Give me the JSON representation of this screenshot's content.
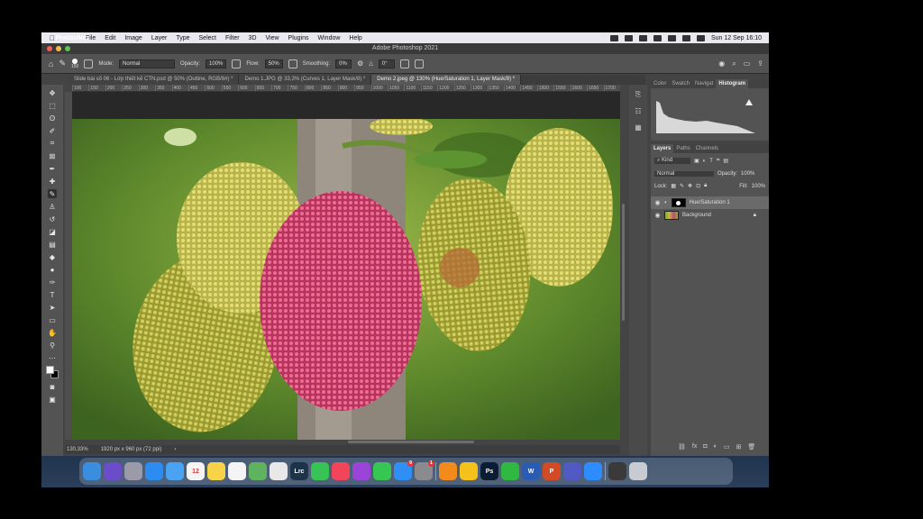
{
  "menubar": {
    "app": "Photoshop",
    "items": [
      "File",
      "Edit",
      "Image",
      "Layer",
      "Type",
      "Select",
      "Filter",
      "3D",
      "View",
      "Plugins",
      "Window",
      "Help"
    ],
    "clock": "Sun 12 Sep  16:10"
  },
  "window": {
    "title": "Adobe Photoshop 2021"
  },
  "options": {
    "brush_size": "150",
    "mode_label": "Mode:",
    "mode_value": "Normal",
    "opacity_label": "Opacity:",
    "opacity_value": "100%",
    "flow_label": "Flow:",
    "flow_value": "50%",
    "smoothing_label": "Smoothing:",
    "smoothing_value": "0%",
    "angle_value": "0°"
  },
  "tabs": [
    {
      "label": "Slide bài số 06 - Lớp thiết kế CTN.psd @ 50% (Outline, RGB/8#) *",
      "active": false
    },
    {
      "label": "Demo 1.JPG @ 33,3% (Curves 1, Layer Mask/8) *",
      "active": false
    },
    {
      "label": "Demo 2.jpeg @ 130% (Hue/Saturation 1, Layer Mask/8) *",
      "active": true
    }
  ],
  "ruler": [
    "100",
    "150",
    "200",
    "250",
    "300",
    "350",
    "400",
    "450",
    "500",
    "550",
    "600",
    "650",
    "700",
    "750",
    "800",
    "850",
    "900",
    "950",
    "1000",
    "1050",
    "1100",
    "1150",
    "1200",
    "1250",
    "1300",
    "1350",
    "1400",
    "1450",
    "1500",
    "1550",
    "1600",
    "1650",
    "1700"
  ],
  "status": {
    "zoom": "130,33%",
    "size": "1920 px x 960 px (72 ppi)",
    "arrow": "›"
  },
  "panels": {
    "top_tabs": [
      "Color",
      "Swatch",
      "Navigat",
      "Histogram"
    ],
    "layer_tabs": [
      "Layers",
      "Paths",
      "Channels"
    ],
    "filter_kind": "Kind",
    "blend_mode": "Normal",
    "opacity_label": "Opacity:",
    "opacity_value": "100%",
    "lock_label": "Lock:",
    "fill_label": "Fill:",
    "fill_value": "100%",
    "layers": [
      {
        "name": "Hue/Saturation 1",
        "selected": true
      },
      {
        "name": "Background",
        "selected": false
      }
    ]
  },
  "dock": [
    {
      "name": "Finder",
      "color": "#3b8de0"
    },
    {
      "name": "Siri",
      "color": "#6b4cc9"
    },
    {
      "name": "Launchpad",
      "color": "#9a9aa8"
    },
    {
      "name": "Safari",
      "color": "#2d8cf0"
    },
    {
      "name": "Mail",
      "color": "#4aa3f2"
    },
    {
      "name": "Calendar",
      "color": "#f4f4f4",
      "text": "12"
    },
    {
      "name": "Notes",
      "color": "#f7d349"
    },
    {
      "name": "Reminders",
      "color": "#f4f4f4"
    },
    {
      "name": "Maps",
      "color": "#5fb35f"
    },
    {
      "name": "Chrome",
      "color": "#e8e8e8"
    },
    {
      "name": "Lightroom Classic",
      "color": "#1c3349",
      "text": "Lrc"
    },
    {
      "name": "FaceTime",
      "color": "#37c455"
    },
    {
      "name": "Music",
      "color": "#f2445a"
    },
    {
      "name": "Podcasts",
      "color": "#9b45d8"
    },
    {
      "name": "Messages",
      "color": "#36c653"
    },
    {
      "name": "App Store",
      "color": "#2f8ff5",
      "badge": "9"
    },
    {
      "name": "System Preferences",
      "color": "#8a8a8f",
      "badge": "1"
    },
    {
      "name": "Infuse",
      "color": "#f28a1c"
    },
    {
      "name": "Keynote Tool",
      "color": "#f5c21b"
    },
    {
      "name": "Photoshop",
      "color": "#0c1c33",
      "text": "Ps"
    },
    {
      "name": "WhatsApp",
      "color": "#2fb943"
    },
    {
      "name": "Word",
      "color": "#2b5cb5",
      "text": "W"
    },
    {
      "name": "PowerPoint",
      "color": "#d24a26",
      "text": "P"
    },
    {
      "name": "Teams",
      "color": "#5159c4"
    },
    {
      "name": "Zoom",
      "color": "#2d8cff"
    },
    {
      "name": "Screenshot",
      "color": "#3a3a3a"
    },
    {
      "name": "Trash",
      "color": "#c8ccd2"
    }
  ]
}
